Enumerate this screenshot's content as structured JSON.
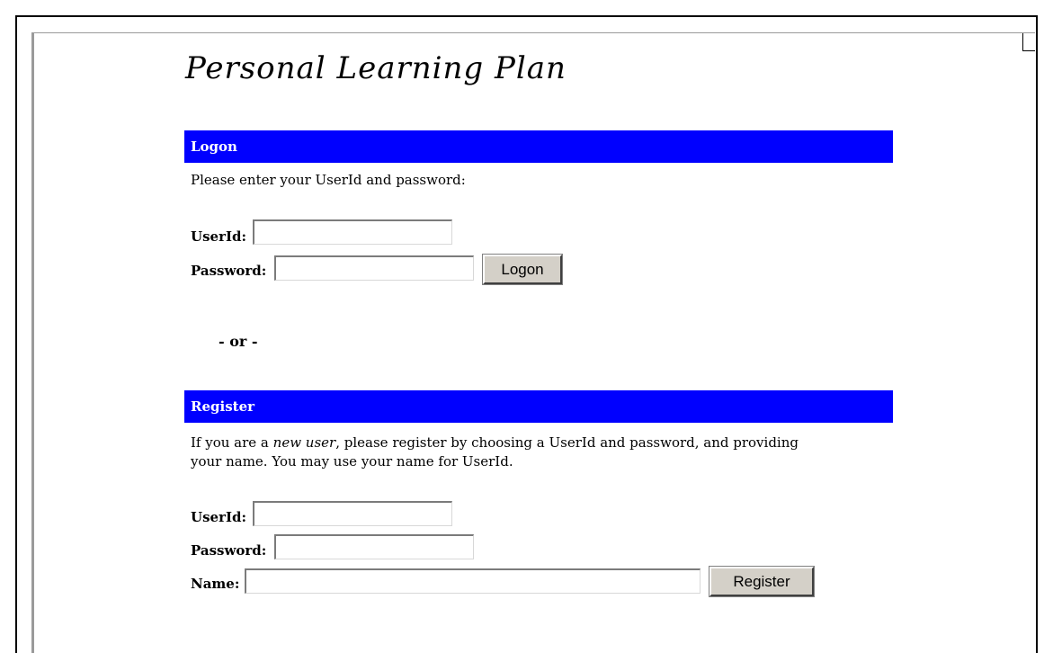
{
  "page": {
    "title": "Personal Learning Plan"
  },
  "logon": {
    "header": "Logon",
    "instruction": "Please enter your UserId and password:",
    "userid_label": "UserId:",
    "userid_value": "",
    "password_label": "Password:",
    "password_value": "",
    "button_label": "Logon"
  },
  "separator": "- or -",
  "register": {
    "header": "Register",
    "instruction_part1": "If you are a ",
    "instruction_em": "new user",
    "instruction_part2": ", please register by choosing a UserId and password, and providing",
    "instruction_line2": "your name. You may use your name for UserId.",
    "userid_label": "UserId:",
    "userid_value": "",
    "password_label": "Password:",
    "password_value": "",
    "name_label": "Name:",
    "name_value": "",
    "button_label": "Register"
  },
  "colors": {
    "section_bar": "#0000ff",
    "section_text": "#ffffff",
    "button_face": "#d4d0c8"
  }
}
